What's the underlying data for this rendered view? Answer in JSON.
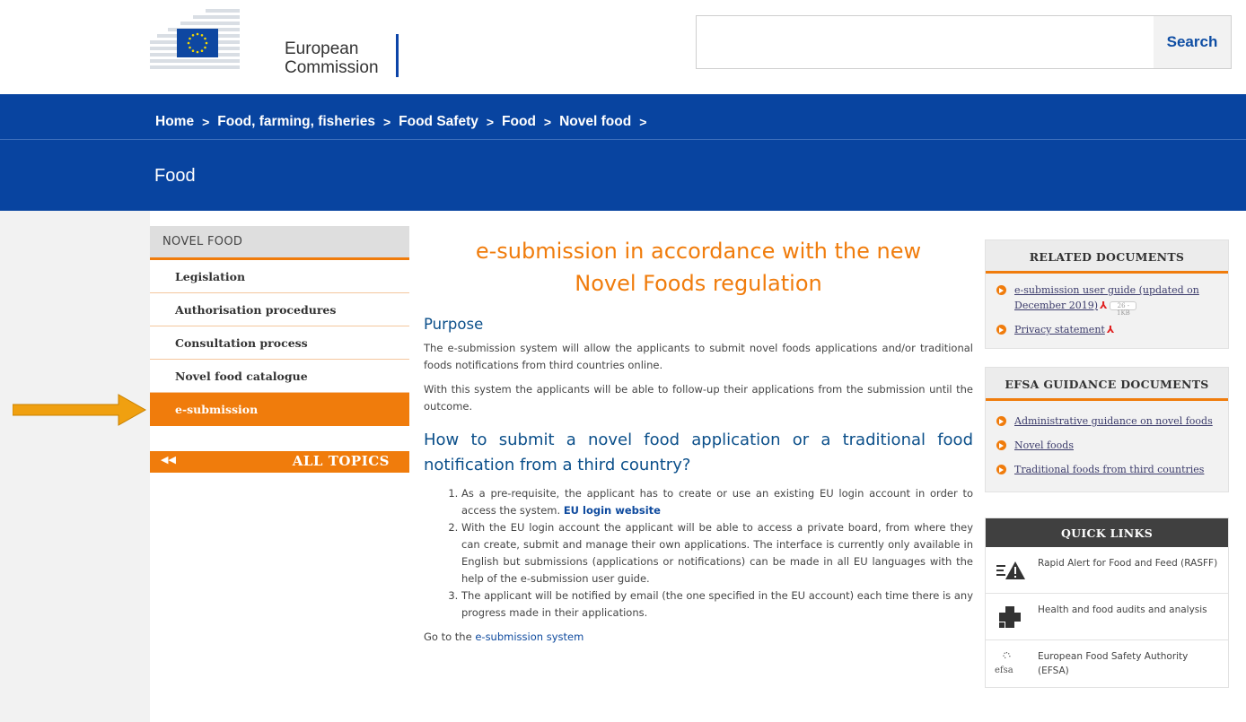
{
  "header": {
    "logo_line1": "European",
    "logo_line2": "Commission",
    "search_placeholder": "",
    "search_button": "Search"
  },
  "breadcrumb": [
    "Home",
    "Food, farming, fisheries",
    "Food Safety",
    "Food",
    "Novel food"
  ],
  "breadcrumb_separator": ">",
  "banner_title": "Food",
  "sidebar": {
    "heading": "NOVEL FOOD",
    "items": [
      {
        "label": "Legislation",
        "active": false
      },
      {
        "label": "Authorisation procedures",
        "active": false
      },
      {
        "label": "Consultation process",
        "active": false
      },
      {
        "label": "Novel food catalogue",
        "active": false
      },
      {
        "label": "e-submission",
        "active": true
      }
    ],
    "all_topics": "ALL TOPICS"
  },
  "main": {
    "title_line1": "e-submission in accordance with the new",
    "title_line2": "Novel Foods regulation",
    "purpose_heading": "Purpose",
    "purpose_p1": "The e-submission system will allow the applicants to submit novel foods applications and/or traditional foods notifications from third countries online.",
    "purpose_p2": "With this system the applicants will be able to follow-up their applications from the submission until the outcome.",
    "how_heading": "How to submit a novel food application or a traditional food notification from a third country?",
    "steps": [
      {
        "text": "As a pre-requisite, the applicant has to create or use an existing EU login account in order to access the system. ",
        "link": "EU login website"
      },
      {
        "text": "With the EU login account the applicant will be able to access a private board, from where they can create, submit and manage their own applications. The interface is currently only available in English but submissions (applications or notifications) can be made in all EU languages with the help of the e-submission user guide."
      },
      {
        "text": "The applicant will be notified by email (the one specified in the EU account) each time there is any progress made in their applications."
      }
    ],
    "go_prefix": "Go to the ",
    "go_link": "e-submission system"
  },
  "related": {
    "heading": "RELATED DOCUMENTS",
    "items": [
      {
        "label": "e-submission user guide (updated on December 2019)",
        "pdf": true,
        "size_badge": "26 - 1KB"
      },
      {
        "label": "Privacy statement",
        "pdf": true
      }
    ]
  },
  "efsa": {
    "heading": "EFSA GUIDANCE DOCUMENTS",
    "items": [
      {
        "label": "Administrative guidance on novel foods"
      },
      {
        "label": "Novel foods"
      },
      {
        "label": "Traditional foods from third countries"
      }
    ]
  },
  "quick_links": {
    "heading": "QUICK LINKS",
    "items": [
      {
        "label": "Rapid Alert for Food and Feed (RASFF)",
        "icon": "rasff-alert-icon"
      },
      {
        "label": "Health and food audits and analysis",
        "icon": "medical-cross-icon"
      },
      {
        "label": "European Food Safety Authority (EFSA)",
        "icon": "efsa-logo-icon",
        "icon_text": "efsa"
      }
    ]
  },
  "colors": {
    "brand_blue": "#0844a0",
    "accent_orange": "#f07c0c",
    "link_blue": "#0e4a9e",
    "heading_blue": "#0b4f8a",
    "annotation_arrow": "#f0a010"
  }
}
